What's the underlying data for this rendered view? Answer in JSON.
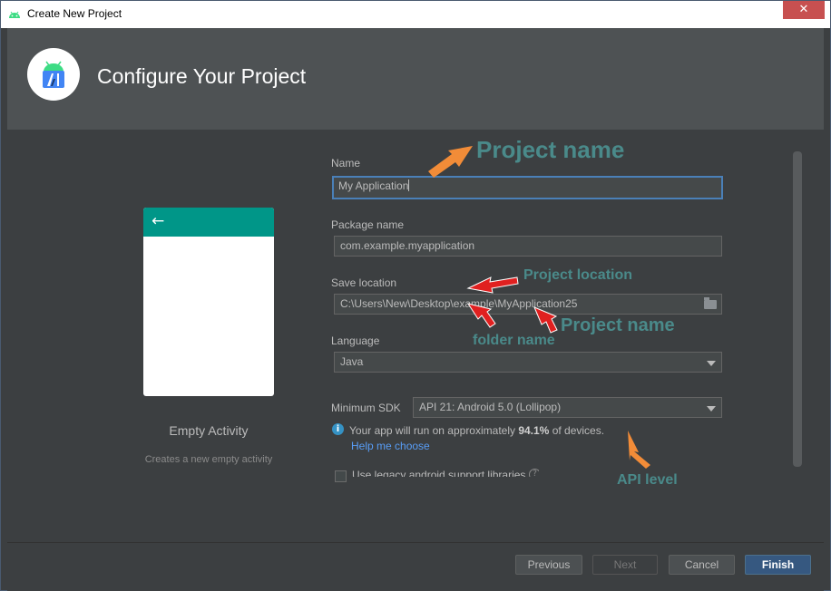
{
  "window": {
    "title": "Create New Project",
    "close_label": "✕"
  },
  "header": {
    "title": "Configure Your Project"
  },
  "template": {
    "name": "Empty Activity",
    "description": "Creates a new empty activity",
    "back_glyph": "←"
  },
  "form": {
    "name_label": "Name",
    "name_value": "My Application",
    "package_label": "Package name",
    "package_value": "com.example.myapplication",
    "save_location_label": "Save location",
    "save_location_value": "C:\\Users\\New\\Desktop\\example\\MyApplication25",
    "language_label": "Language",
    "language_value": "Java",
    "min_sdk_label": "Minimum SDK",
    "min_sdk_value": "API 21: Android 5.0 (Lollipop)",
    "info_prefix": "Your app will run on approximately ",
    "info_percent": "94.1%",
    "info_suffix": " of devices.",
    "help_link": "Help me choose",
    "legacy_label": "Use legacy android.support libraries",
    "info_icon_glyph": "i",
    "help_glyph": "?"
  },
  "footer": {
    "previous": "Previous",
    "next": "Next",
    "cancel": "Cancel",
    "finish": "Finish"
  },
  "annotations": {
    "project_name_top": "Project name",
    "project_location": "Project location",
    "project_name_bottom": "Project name",
    "folder_name": "folder name",
    "api_level": "API level"
  },
  "colors": {
    "accent": "#009688",
    "link": "#589df6",
    "annotation_text": "#4a8a8a",
    "arrow_orange": "#f28c38",
    "arrow_red": "#e02020"
  },
  "icons": {
    "app": "android-studio-icon",
    "close": "close-icon",
    "folder": "folder-icon",
    "dropdown": "chevron-down-icon",
    "info": "info-icon",
    "help": "help-icon"
  }
}
